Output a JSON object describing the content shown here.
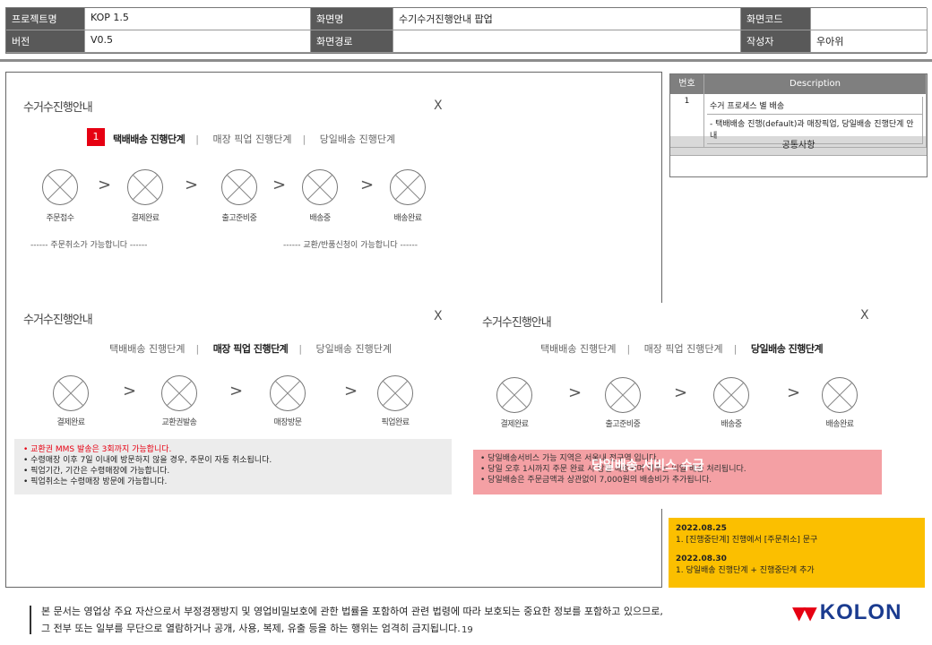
{
  "header": {
    "project_label": "프로젝트명",
    "project_value": "KOP 1.5",
    "screen_label": "화면명",
    "screen_value": "수기수거진행안내 팝업",
    "code_label": "화면코드",
    "code_value": "",
    "version_label": "버전",
    "version_value": "V0.5",
    "path_label": "화면경로",
    "path_value": "",
    "author_label": "작성자",
    "author_value": "우아위"
  },
  "dialog1": {
    "title": "수거수진행안내",
    "close": "X",
    "badge": "1",
    "tabs": [
      "택배배송 진행단계",
      "매장 픽업 진행단계",
      "당일배송 진행단계"
    ],
    "steps": [
      "주문접수",
      "결제완료",
      "출고준비중",
      "배송중",
      "배송완료"
    ],
    "note_left": "------ 주문취소가 가능합니다 ------",
    "note_right": "------ 교환/반품신청이 가능합니다 ------"
  },
  "dialog2": {
    "title": "수거수진행안내",
    "close": "X",
    "tabs": [
      "택배배송 진행단계",
      "매장 픽업 진행단계",
      "당일배송 진행단계"
    ],
    "steps": [
      "결제완료",
      "교환권발송",
      "매장방문",
      "픽업완료"
    ],
    "info": [
      "교환권 MMS 발송은 3회까지 가능합니다.",
      "수령매장 이후 7일 이내에 방문하지 않을 경우, 주문이 자동 취소됩니다.",
      "픽업기간, 기간은 수령매장에 가능합니다.",
      "픽업취소는 수령매장 방문에 가능합니다."
    ]
  },
  "dialog3": {
    "title": "수거수진행안내",
    "close": "X",
    "tabs": [
      "택배배송 진행단계",
      "매장 픽업 진행단계",
      "당일배송 진행단계"
    ],
    "steps": [
      "결제완료",
      "출고준비중",
      "배송중",
      "배송완료"
    ],
    "info": [
      "당일배송서비스 가능 지역은 서울내 전구역 입니다.",
      "당일 오후 1시까지 주문 완료 시 당일 배송되며 이후는 익일 배송 처리됩니다.",
      "당일배송은 주문금액과 상관없이 7,000원의 배송비가 추가됩니다."
    ],
    "overlay": "당일배송 서비스 수급"
  },
  "side_panel": {
    "col1": "번호",
    "col2": "Description",
    "num": "1",
    "desc_title": "수거 프로세스 별 배송",
    "desc_body": "- 택배배송 진행(default)과 매장픽업, 당일배송 진행단계 안내",
    "footer": "공통사항"
  },
  "yellow_note": {
    "date1": "2022.08.25",
    "item1": "1. [진행중단계] 진행에서 [주문취소] 문구",
    "date2": "2022.08.30",
    "item2": "1. 당일배송 진행단계 + 진행중단계 추가"
  },
  "footer": {
    "line1": "본 문서는 영업상 주요 자산으로서 부정경쟁방지 및 영업비밀보호에 관한 법률을 포함하여 관련 법령에 따라 보호되는 중요한 정보를 포함하고 있으므로,",
    "line2": "그 전부 또는 일부를 무단으로 열람하거나 공개, 사용, 복제, 유출 등을 하는 행위는 엄격히 금지됩니다.",
    "page": "19",
    "logo": "KOLON"
  }
}
